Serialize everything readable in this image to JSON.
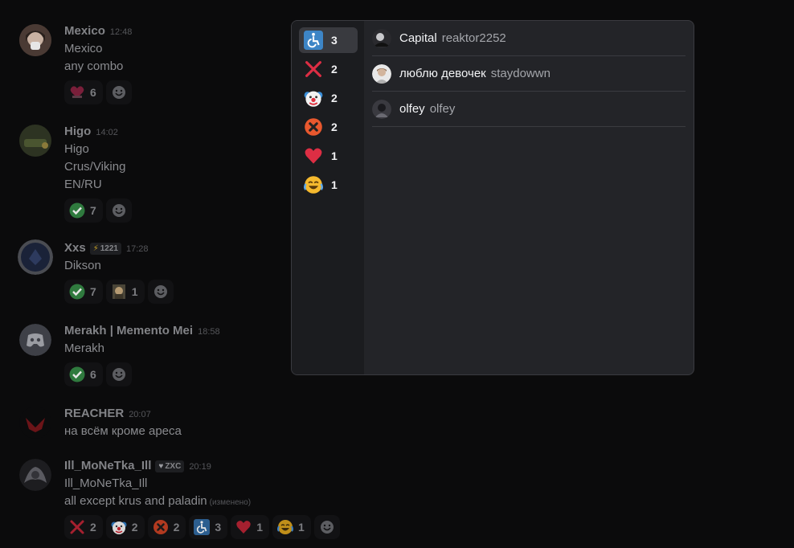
{
  "messages": [
    {
      "author": "Mexico",
      "time": "12:48",
      "lines": [
        "Mexico",
        "any combo"
      ],
      "avatar_color": "#3b2e2b",
      "reactions": [
        {
          "emoji": "heart-sticker",
          "count": "6"
        }
      ]
    },
    {
      "author": "Higo",
      "time": "14:02",
      "lines": [
        "Higo",
        "Crus/Viking",
        "EN/RU"
      ],
      "avatar_color": "#2d3322",
      "reactions": [
        {
          "emoji": "check-mark",
          "count": "7"
        }
      ]
    },
    {
      "author": "Xxs",
      "tag": "1221",
      "time": "17:28",
      "lines": [
        "Dikson"
      ],
      "avatar_color": "#1d2433",
      "reactions": [
        {
          "emoji": "check-mark",
          "count": "7"
        },
        {
          "emoji": "custom-face",
          "count": "1"
        }
      ]
    },
    {
      "author": "Merakh | Memento Mei",
      "time": "18:58",
      "lines": [
        "Merakh"
      ],
      "avatar_color": "#3e4047",
      "reactions": [
        {
          "emoji": "check-mark",
          "count": "6"
        }
      ]
    },
    {
      "author": "REACHER",
      "time": "20:07",
      "lines": [
        "на всём кроме ареса"
      ],
      "avatar_color": "#0b0b0c",
      "reactions": []
    },
    {
      "author": "Ill_MoNeTka_Ill",
      "tag": "ZXC",
      "time": "20:19",
      "lines": [
        "Ill_MoNeTka_Ill",
        "all except krus and paladin"
      ],
      "edited": "(изменено)",
      "avatar_color": "#222226",
      "reactions": [
        {
          "emoji": "cross-mark",
          "count": "2"
        },
        {
          "emoji": "clown",
          "count": "2"
        },
        {
          "emoji": "x-circle",
          "count": "2"
        },
        {
          "emoji": "wheelchair",
          "count": "3"
        },
        {
          "emoji": "red-heart",
          "count": "1"
        },
        {
          "emoji": "joy",
          "count": "1"
        }
      ]
    }
  ],
  "popup": {
    "tabs": [
      {
        "emoji": "wheelchair",
        "count": "3",
        "selected": true
      },
      {
        "emoji": "cross-mark",
        "count": "2"
      },
      {
        "emoji": "clown",
        "count": "2"
      },
      {
        "emoji": "x-circle",
        "count": "2"
      },
      {
        "emoji": "red-heart",
        "count": "1"
      },
      {
        "emoji": "joy",
        "count": "1"
      }
    ],
    "users": [
      {
        "name": "Capital",
        "handle": "reaktor2252"
      },
      {
        "name": "люблю девочек",
        "handle": "staydowwn"
      },
      {
        "name": "olfey",
        "handle": "olfey"
      }
    ]
  },
  "colors": {
    "accent": "#3b82f6",
    "green": "#3ba55c",
    "red": "#dd2e44"
  }
}
